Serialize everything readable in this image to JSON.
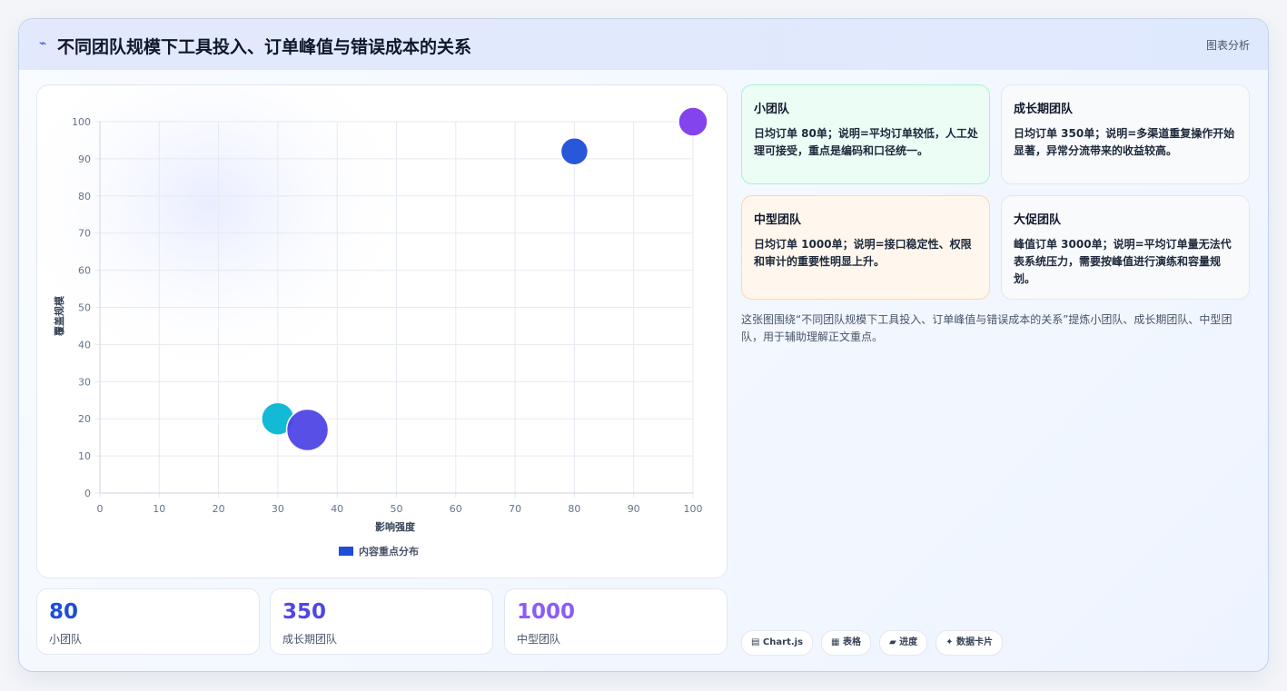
{
  "header": {
    "title": "不同团队规模下工具投入、订单峰值与错误成本的关系",
    "tag": "图表分析",
    "icon": "lightning-icon"
  },
  "chart_data": {
    "type": "scatter",
    "xlabel": "影响强度",
    "ylabel": "覆盖规模",
    "xlim": [
      0,
      100
    ],
    "ylim": [
      0,
      100
    ],
    "xticks": [
      0,
      10,
      20,
      30,
      40,
      50,
      60,
      70,
      80,
      90,
      100
    ],
    "yticks": [
      0,
      10,
      20,
      30,
      40,
      50,
      60,
      70,
      80,
      90,
      100
    ],
    "grid": true,
    "legend": "bottom",
    "series": [
      {
        "name": "内容重点分布",
        "color": "#1d4ed8",
        "points": [
          {
            "x": 30,
            "y": 20,
            "r": 18,
            "color": "#06b6d4"
          },
          {
            "x": 35,
            "y": 17,
            "r": 23,
            "color": "#4f46e5"
          },
          {
            "x": 80,
            "y": 92,
            "r": 15,
            "color": "#1d4ed8"
          },
          {
            "x": 100,
            "y": 100,
            "r": 16,
            "color": "#7c3aed"
          }
        ]
      }
    ]
  },
  "stats": [
    {
      "value": "80",
      "label": "小团队",
      "color": "#1d4ed8"
    },
    {
      "value": "350",
      "label": "成长期团队",
      "color": "#4f46e5"
    },
    {
      "value": "1000",
      "label": "中型团队",
      "color": "#8b5cf6"
    }
  ],
  "info_cards": [
    {
      "title": "小团队",
      "text": "日均订单 80单；说明=平均订单较低，人工处理可接受，重点是编码和口径统一。",
      "bg": "#ecfdf5",
      "border": "#a7f3d0"
    },
    {
      "title": "成长期团队",
      "text": "日均订单 350单；说明=多渠道重复操作开始显著，异常分流带来的收益较高。",
      "bg": "#f8fafc",
      "border": "#e2e8f0"
    },
    {
      "title": "中型团队",
      "text": "日均订单 1000单；说明=接口稳定性、权限和审计的重要性明显上升。",
      "bg": "#fff7ed",
      "border": "#fed7aa"
    },
    {
      "title": "大促团队",
      "text": "峰值订单 3000单；说明=平均订单量无法代表系统压力，需要按峰值进行演练和容量规划。",
      "bg": "#f8fafc",
      "border": "#e2e8f0"
    }
  ],
  "summary": "这张图围绕“不同团队规模下工具投入、订单峰值与错误成本的关系”提炼小团队、成长期团队、中型团队，用于辅助理解正文重点。",
  "chips": [
    {
      "label": "▤ Chart.js"
    },
    {
      "label": "▦ 表格"
    },
    {
      "label": "▰ 进度"
    },
    {
      "label": "✦ 数据卡片"
    }
  ]
}
